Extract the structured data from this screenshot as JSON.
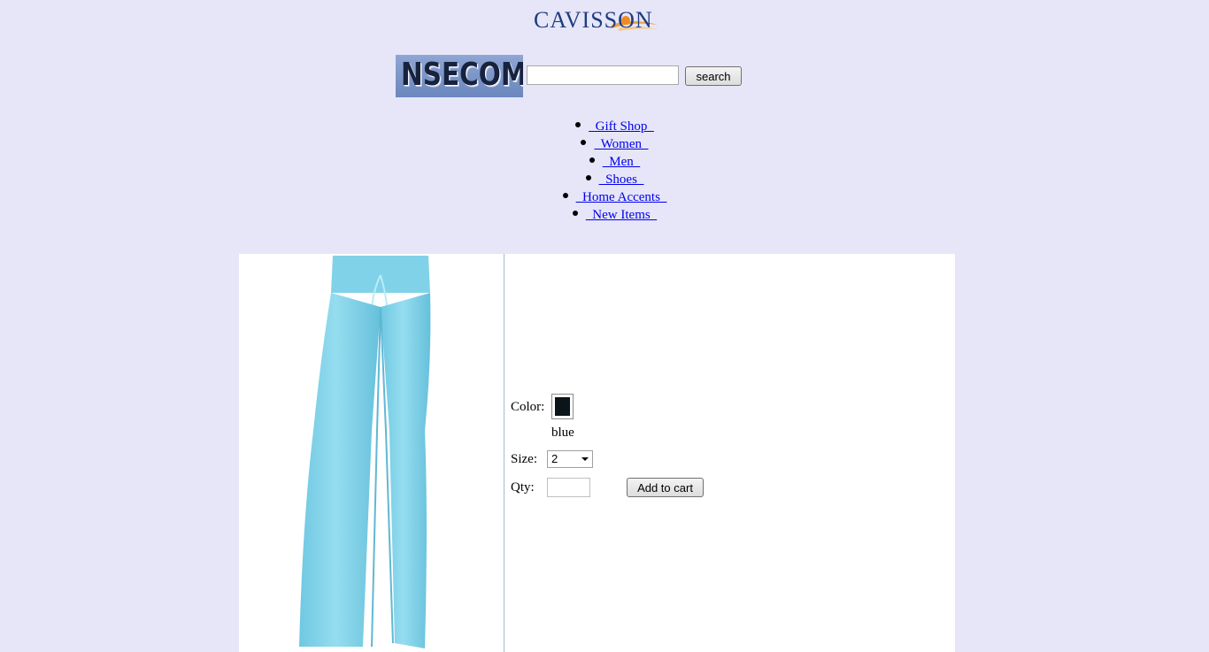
{
  "header": {
    "logo_text": "CAVISSON",
    "logo_image_name": "cavisson-logo",
    "brand_badge_text": "NSECOM",
    "search": {
      "value": "",
      "placeholder": "",
      "button_label": "search"
    }
  },
  "nav": {
    "items": [
      {
        "label": "  Gift Shop  "
      },
      {
        "label": "  Women  "
      },
      {
        "label": "  Men  "
      },
      {
        "label": "  Shoes  "
      },
      {
        "label": "  Home Accents  "
      },
      {
        "label": "  New Items  "
      }
    ],
    "link_color": "#0000ee"
  },
  "product": {
    "image_name": "light-blue-pants-image",
    "image_color": "#87d6ea",
    "color_label": "Color:",
    "color_swatch": "#0b1418",
    "color_name": "blue",
    "size_label": "Size:",
    "size_value": "2",
    "qty_label": "Qty:",
    "qty_value": "",
    "add_to_cart_label": "Add to cart"
  },
  "colors": {
    "page_background": "#e6e6f8",
    "panel_background": "#ffffff",
    "divider": "#a8b8d8"
  }
}
